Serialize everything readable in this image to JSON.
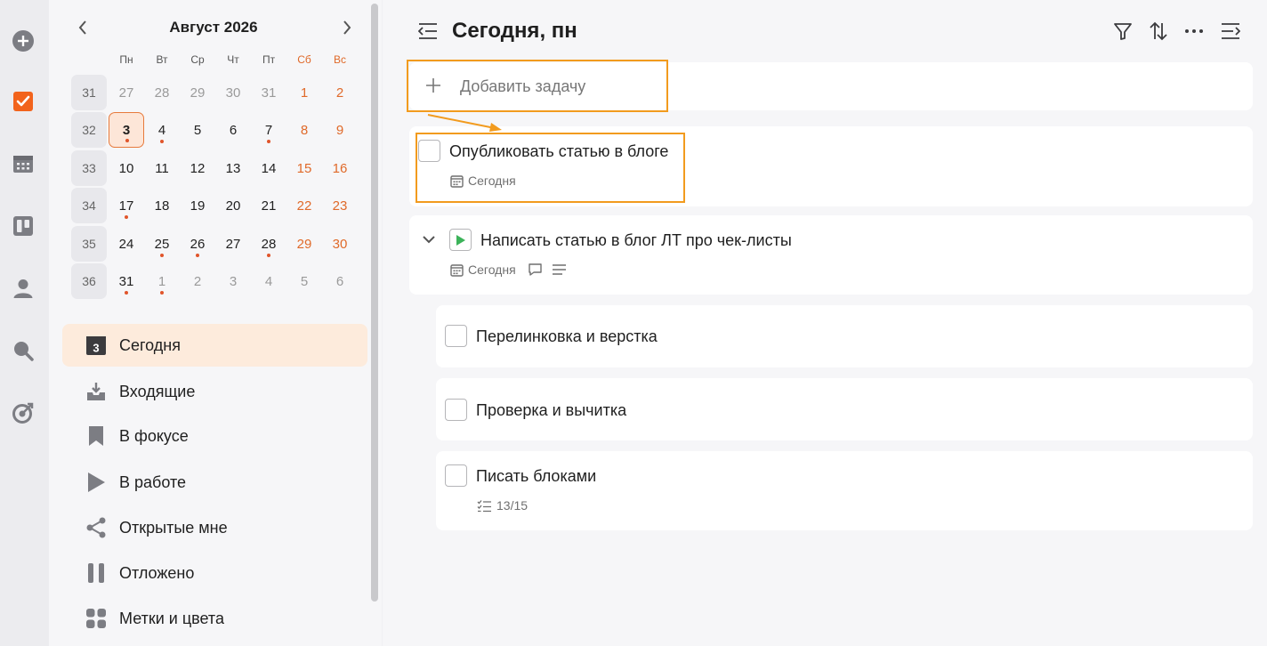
{
  "calendar": {
    "title": "Август 2026",
    "weekdays": [
      "Пн",
      "Вт",
      "Ср",
      "Чт",
      "Пт",
      "Сб",
      "Вс"
    ],
    "weeks": [
      {
        "num": "31",
        "days": [
          {
            "d": "27",
            "state": "other"
          },
          {
            "d": "28",
            "state": "other"
          },
          {
            "d": "29",
            "state": "other"
          },
          {
            "d": "30",
            "state": "other"
          },
          {
            "d": "31",
            "state": "other"
          },
          {
            "d": "1",
            "state": "weekend"
          },
          {
            "d": "2",
            "state": "weekend"
          }
        ]
      },
      {
        "num": "32",
        "days": [
          {
            "d": "3",
            "state": "today",
            "dot": true
          },
          {
            "d": "4",
            "state": "normal",
            "dot": true
          },
          {
            "d": "5",
            "state": "normal"
          },
          {
            "d": "6",
            "state": "normal"
          },
          {
            "d": "7",
            "state": "normal",
            "dot": true
          },
          {
            "d": "8",
            "state": "weekend"
          },
          {
            "d": "9",
            "state": "weekend"
          }
        ]
      },
      {
        "num": "33",
        "days": [
          {
            "d": "10",
            "state": "normal"
          },
          {
            "d": "11",
            "state": "normal"
          },
          {
            "d": "12",
            "state": "normal"
          },
          {
            "d": "13",
            "state": "normal"
          },
          {
            "d": "14",
            "state": "normal"
          },
          {
            "d": "15",
            "state": "weekend"
          },
          {
            "d": "16",
            "state": "weekend"
          }
        ]
      },
      {
        "num": "34",
        "days": [
          {
            "d": "17",
            "state": "normal",
            "dot": true
          },
          {
            "d": "18",
            "state": "normal"
          },
          {
            "d": "19",
            "state": "normal"
          },
          {
            "d": "20",
            "state": "normal"
          },
          {
            "d": "21",
            "state": "normal"
          },
          {
            "d": "22",
            "state": "weekend"
          },
          {
            "d": "23",
            "state": "weekend"
          }
        ]
      },
      {
        "num": "35",
        "days": [
          {
            "d": "24",
            "state": "normal"
          },
          {
            "d": "25",
            "state": "normal",
            "dot": true
          },
          {
            "d": "26",
            "state": "normal",
            "dot": true
          },
          {
            "d": "27",
            "state": "normal"
          },
          {
            "d": "28",
            "state": "normal",
            "dot": true
          },
          {
            "d": "29",
            "state": "weekend"
          },
          {
            "d": "30",
            "state": "weekend"
          }
        ]
      },
      {
        "num": "36",
        "days": [
          {
            "d": "31",
            "state": "normal",
            "dot": true
          },
          {
            "d": "1",
            "state": "other",
            "dot": true
          },
          {
            "d": "2",
            "state": "other"
          },
          {
            "d": "3",
            "state": "other"
          },
          {
            "d": "4",
            "state": "other"
          },
          {
            "d": "5",
            "state": "other"
          },
          {
            "d": "6",
            "state": "other"
          }
        ]
      }
    ]
  },
  "nav": {
    "today_badge": "3",
    "items": [
      {
        "label": "Сегодня",
        "icon": "calendar-today-icon",
        "active": true
      },
      {
        "label": "Входящие",
        "icon": "inbox-icon"
      },
      {
        "label": "В фокусе",
        "icon": "bookmark-icon"
      },
      {
        "label": "В работе",
        "icon": "play-icon"
      },
      {
        "label": "Открытые мне",
        "icon": "share-icon"
      },
      {
        "label": "Отложено",
        "icon": "pause-icon"
      },
      {
        "label": "Метки и цвета",
        "icon": "tags-grid-icon"
      }
    ]
  },
  "header": {
    "title": "Сегодня, пн"
  },
  "add_task": {
    "placeholder": "Добавить задачу"
  },
  "tasks": [
    {
      "title": "Опубликовать статью в блоге",
      "date": "Сегодня"
    },
    {
      "title": "Написать статью в блог ЛТ про чек-листы",
      "date": "Сегодня",
      "status": "in-progress"
    },
    {
      "title": "Перелинковка и верстка"
    },
    {
      "title": "Проверка и вычитка"
    },
    {
      "title": "Писать блоками",
      "checklist": "13/15"
    }
  ],
  "colors": {
    "accent": "#f2631c",
    "highlight": "#f29b1e",
    "weekend": "#e06a2a",
    "progress_green": "#3cb35a"
  }
}
